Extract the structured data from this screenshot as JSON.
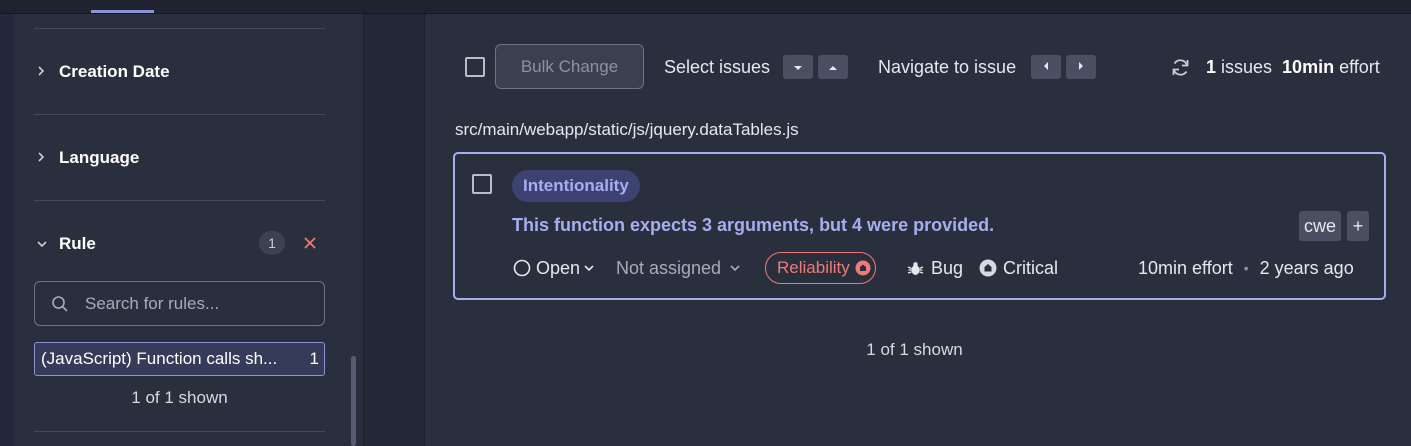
{
  "sidebar": {
    "facets": [
      {
        "label": "Creation Date",
        "expanded": false
      },
      {
        "label": "Language",
        "expanded": false
      },
      {
        "label": "Rule",
        "expanded": true,
        "count": "1"
      }
    ],
    "rule_search": {
      "placeholder": "Search for rules..."
    },
    "rule_item": {
      "label": "(JavaScript) Function calls sh...",
      "count": "1"
    },
    "rule_shown": "1 of 1 shown",
    "icons": {
      "chevron_right": "chevron-right-icon",
      "chevron_down": "chevron-down-icon",
      "clear": "close-icon",
      "search": "search-icon"
    }
  },
  "toolbar": {
    "bulk_change_label": "Bulk Change",
    "select_issues_label": "Select issues",
    "navigate_label": "Navigate to issue",
    "issues_count": "1",
    "issues_word": "issues",
    "effort_value": "10min",
    "effort_word": "effort"
  },
  "issues": {
    "file_path": "src/main/webapp/static/js/jquery.dataTables.js",
    "items": [
      {
        "attribute": "Intentionality",
        "message": "This function expects 3 arguments, but 4 were provided.",
        "tags": [
          "cwe"
        ],
        "add_tag": "+",
        "status": "Open",
        "assignee": "Not assigned",
        "quality": "Reliability",
        "type": "Bug",
        "severity": "Critical",
        "effort": "10min effort",
        "age": "2 years ago"
      }
    ],
    "shown": "1 of 1 shown"
  },
  "colors": {
    "accent": "#a7aef0",
    "danger": "#f07a76",
    "background": "#2a2f3d"
  }
}
